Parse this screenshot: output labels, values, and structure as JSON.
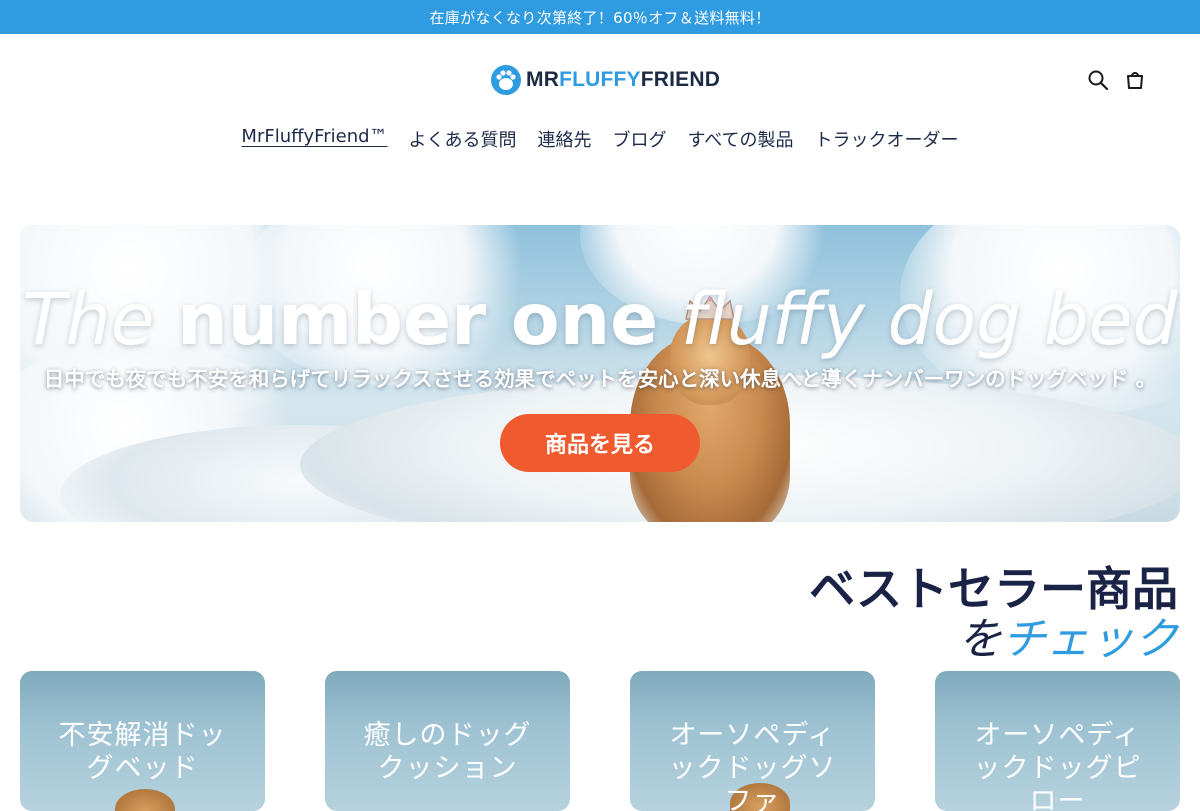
{
  "announcement": "在庫がなくなり次第終了！60％オフ＆送料無料！",
  "logo": {
    "part1": "MR",
    "part2": "FLUFFY",
    "part3": "FRIEND"
  },
  "nav": [
    {
      "label": "MrFluffyFriend™",
      "active": true
    },
    {
      "label": "よくある質問"
    },
    {
      "label": "連絡先"
    },
    {
      "label": "ブログ"
    },
    {
      "label": "すべての製品"
    },
    {
      "label": "トラックオーダー"
    }
  ],
  "header_icons": {
    "search": "search-icon",
    "cart": "cart-icon"
  },
  "hero": {
    "title_part1": "The",
    "title_part2": "number one",
    "title_part3": "fluffy dog bed",
    "subtitle": "日中でも夜でも不安を和らげてリラックスさせる効果でペットを安心と深い休息へと導くナンバーワンのドッグベッド 。",
    "cta": "商品を見る"
  },
  "bestsellers": {
    "line1": "ベストセラー商品",
    "line2_a": "を",
    "line2_b": "チェック"
  },
  "products": [
    {
      "title": "不安解消ドッグベッド"
    },
    {
      "title": "癒しのドッグクッション"
    },
    {
      "title": "オーソペディックドッグソファ"
    },
    {
      "title": "オーソペディックドッグピロー"
    }
  ],
  "colors": {
    "brand_blue": "#2f9be0",
    "navy": "#1a2246",
    "cta_orange": "#ef5a2e"
  }
}
